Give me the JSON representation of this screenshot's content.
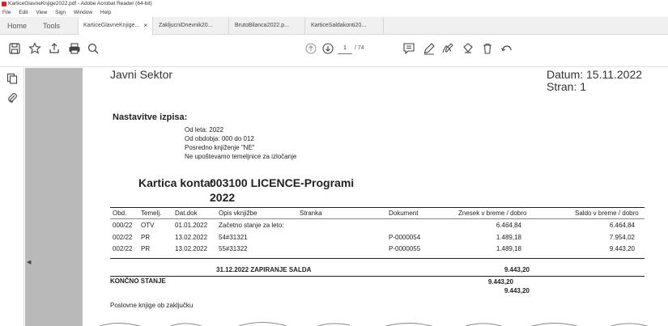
{
  "window": {
    "title": "KarticeGlavneKnjige2022.pdf - Adobe Acrobat Reader (64-bit)"
  },
  "menu": [
    "File",
    "Edit",
    "View",
    "Sign",
    "Window",
    "Help"
  ],
  "nav": {
    "home": "Home",
    "tools": "Tools"
  },
  "tabs": [
    {
      "label": "KarticeGlavneKnjige...",
      "close": "×"
    },
    {
      "label": "ZakljucniDnevnik20..."
    },
    {
      "label": "BrutoBilanca2022.p..."
    },
    {
      "label": "KarticeSaldakonti20..."
    }
  ],
  "toolbar": {
    "page_current": "1",
    "page_total": "/ 74"
  },
  "doc": {
    "org": "Javni Sektor",
    "datum": "Datum: 15.11.2022",
    "stran": "Stran: 1",
    "settings_title": "Nastavitve izpisa:",
    "settings": [
      "Od leta: 2022",
      "Od obdobja: 000 do 012",
      "Posredno knjiženje \"NE\"",
      "Ne upoštevamo temeljnice za izločanje"
    ],
    "kartica_label": "Kartica konta:",
    "kartica_value": "003100 LICENCE-Programi",
    "year": "2022",
    "columns": [
      "Obd.",
      "Temelj.",
      "Dat.dok",
      "Opis vknjižbe",
      "Stranka",
      "Dokument",
      "Znesek v breme / dobro",
      "Saldo v breme / dobro"
    ],
    "rows": [
      {
        "obd": "000/22",
        "temelj": "OTV",
        "datdok": "01.01.2022",
        "opis": "Začetno stanje za leto:",
        "stranka": "",
        "dokument": "",
        "znesek": "6.464,84",
        "saldo": "6.464,84"
      },
      {
        "obd": "002/22",
        "temelj": "PR",
        "datdok": "13.02.2022",
        "opis": "54#31321",
        "stranka": "",
        "dokument": "P-0000054",
        "znesek": "1.489,18",
        "saldo": "7.954,02"
      },
      {
        "obd": "002/22",
        "temelj": "PR",
        "datdok": "13.02.2022",
        "opis": "55#31322",
        "stranka": "",
        "dokument": "P-0000055",
        "znesek": "1.489,18",
        "saldo": "9.443,20"
      }
    ],
    "closing_label": "31.12.2022 ZAPIRANJE SALDA",
    "closing_value": "9.443,20",
    "final_label": "KONČNO STANJE",
    "final_value_1": "9.443,20",
    "final_value_2": "9.443,20",
    "footer": "Poslovne knjige ob zaključku"
  },
  "colors": {
    "acrobat_red": "#d9251c",
    "gray_panel": "#b9b9b9"
  }
}
